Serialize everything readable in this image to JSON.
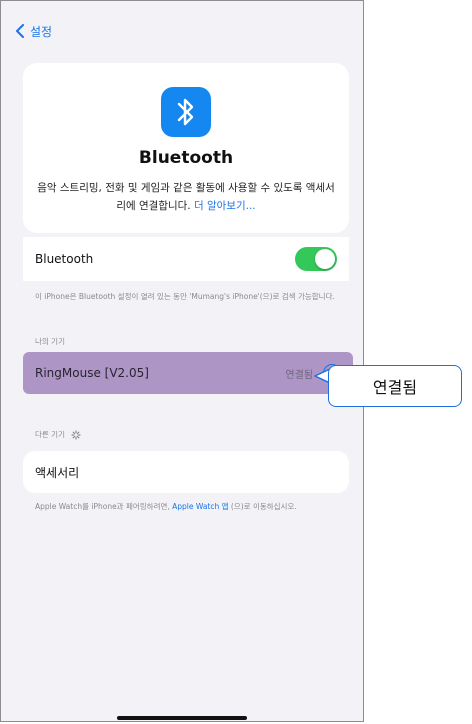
{
  "nav": {
    "back_label": "설정"
  },
  "hero": {
    "title": "Bluetooth",
    "desc_text": "음악 스트리밍, 전화 및 게임과 같은 활동에 사용할 수 있도록 액세서리에 연결합니다.",
    "learn_more": "더 알아보기..."
  },
  "bluetooth_toggle": {
    "label": "Bluetooth",
    "state": "on",
    "on_color": "#34c759"
  },
  "bluetooth_note": "이 iPhone은 Bluetooth 설정이 열려 있는 동안 'Mumang's iPhone'(으)로 검색 가능합니다.",
  "my_devices": {
    "header": "나의 기기",
    "items": [
      {
        "name": "RingMouse [V2.05]",
        "status": "연결됨",
        "highlight_color": "#ad96c6"
      }
    ]
  },
  "other_devices": {
    "header": "다른 기기"
  },
  "accessory": {
    "label": "액세서리"
  },
  "watch_note": {
    "text": "Apple Watch를 iPhone과 페어링하려면,",
    "link": "Apple Watch 앱",
    "suffix": "(으)로 이동하십시오."
  },
  "callout": {
    "text": "연결됨",
    "border_color": "#1f6fe0"
  }
}
